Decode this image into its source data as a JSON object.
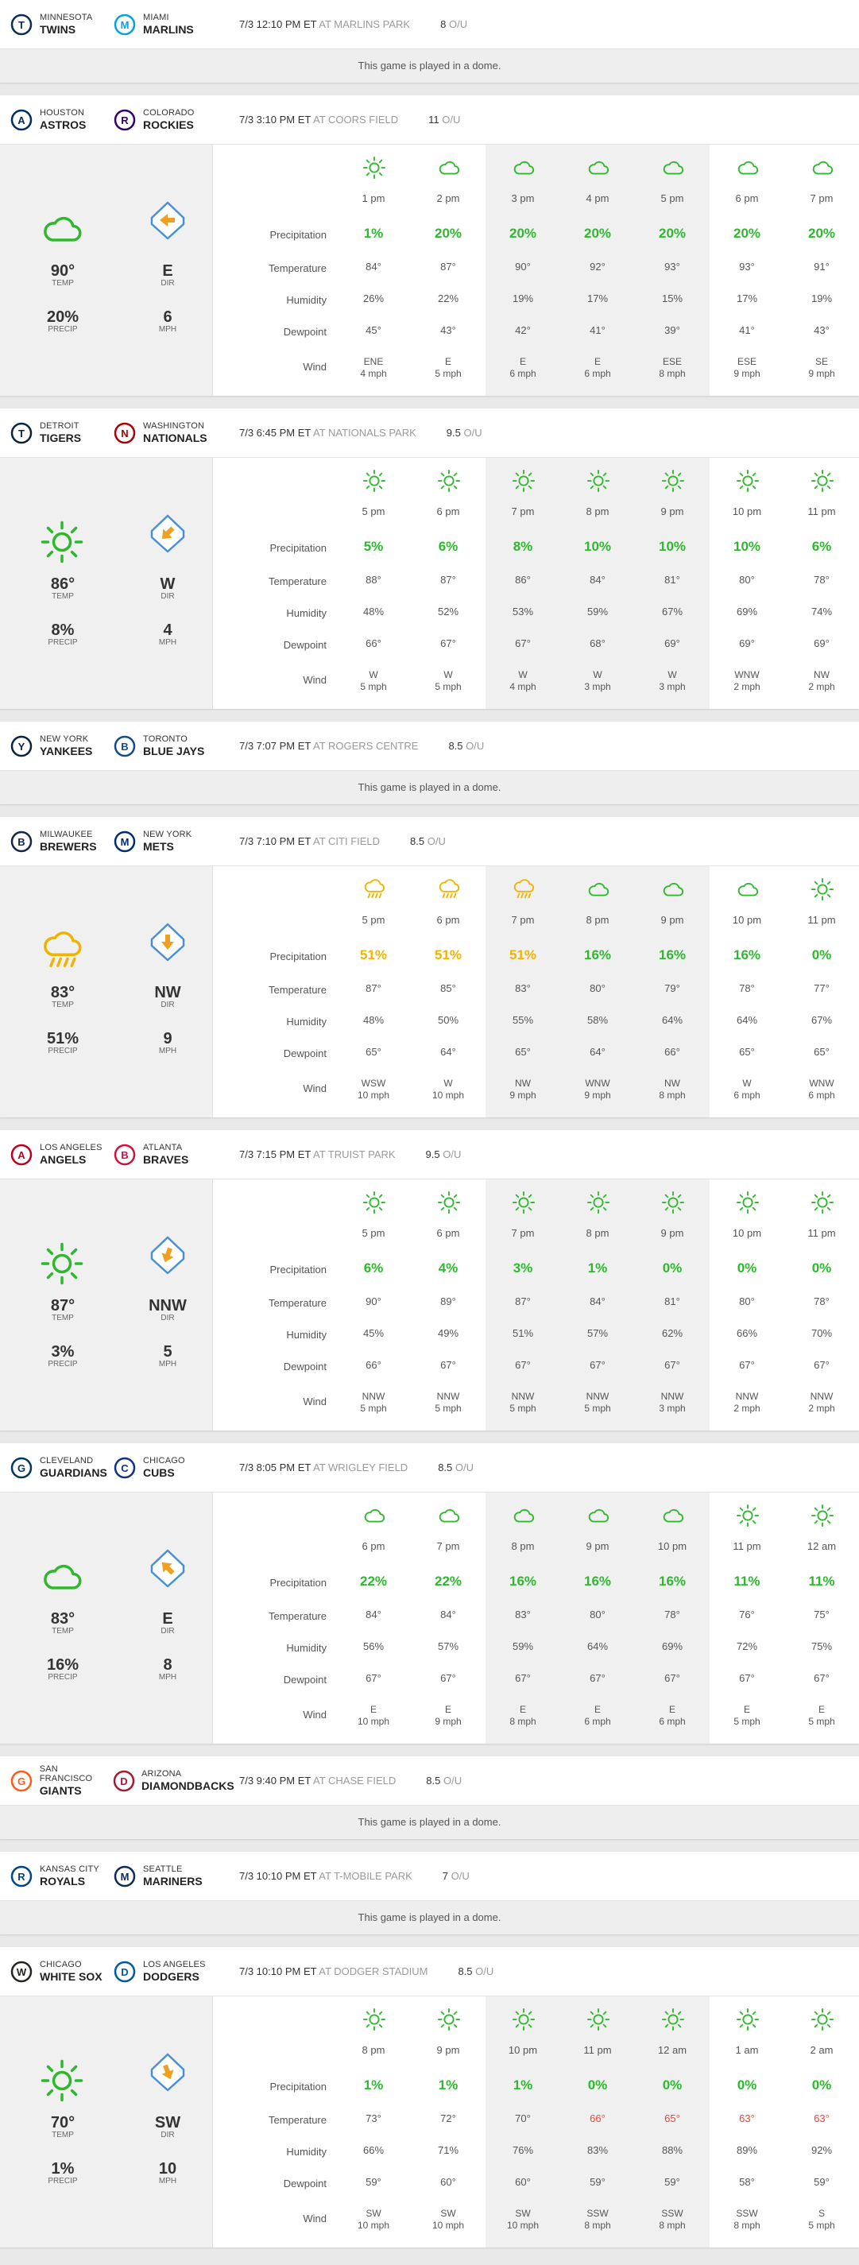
{
  "games": [
    {
      "away": {
        "city": "MINNESOTA",
        "nick": "TWINS",
        "logo": "twins-logo",
        "color": "#0c2c56"
      },
      "home": {
        "city": "MIAMI",
        "nick": "MARLINS",
        "logo": "marlins-logo",
        "color": "#00a3e0"
      },
      "datetime": "7/3 12:10 PM ET",
      "park": "AT MARLINS PARK",
      "ou": "8",
      "ou_label": "O/U",
      "dome": "This game is played in a dome."
    },
    {
      "away": {
        "city": "HOUSTON",
        "nick": "ASTROS",
        "logo": "astros-logo",
        "color": "#002d62"
      },
      "home": {
        "city": "COLORADO",
        "nick": "ROCKIES",
        "logo": "rockies-logo",
        "color": "#33006f"
      },
      "datetime": "7/3 3:10 PM ET",
      "park": "AT COORS FIELD",
      "ou": "11",
      "ou_label": "O/U",
      "summary": {
        "condition": "cloud-icon",
        "arrow_rotate": 270,
        "temp": "90°",
        "temp_label": "TEMP",
        "precip": "20%",
        "precip_label": "PRECIP",
        "dir": "E",
        "dir_label": "DIR",
        "mph": "6",
        "mph_label": "MPH"
      },
      "labels": {
        "precip": "Precipitation",
        "temp": "Temperature",
        "humidity": "Humidity",
        "dewpoint": "Dewpoint",
        "wind": "Wind"
      },
      "hours": [
        {
          "time": "1 pm",
          "icon": "sun-icon",
          "precip": "1%",
          "pcolor": "green",
          "temp": "84°",
          "humidity": "26%",
          "dewpoint": "45°",
          "wind_dir": "ENE",
          "wind_speed": "4 mph"
        },
        {
          "time": "2 pm",
          "icon": "cloud-icon",
          "precip": "20%",
          "pcolor": "green",
          "temp": "87°",
          "humidity": "22%",
          "dewpoint": "43°",
          "wind_dir": "E",
          "wind_speed": "5 mph"
        },
        {
          "time": "3 pm",
          "icon": "cloud-icon",
          "precip": "20%",
          "pcolor": "green",
          "temp": "90°",
          "humidity": "19%",
          "dewpoint": "42°",
          "wind_dir": "E",
          "wind_speed": "6 mph"
        },
        {
          "time": "4 pm",
          "icon": "cloud-icon",
          "precip": "20%",
          "pcolor": "green",
          "temp": "92°",
          "humidity": "17%",
          "dewpoint": "41°",
          "wind_dir": "E",
          "wind_speed": "6 mph"
        },
        {
          "time": "5 pm",
          "icon": "cloud-icon",
          "precip": "20%",
          "pcolor": "green",
          "temp": "93°",
          "humidity": "15%",
          "dewpoint": "39°",
          "wind_dir": "ESE",
          "wind_speed": "8 mph"
        },
        {
          "time": "6 pm",
          "icon": "cloud-icon",
          "precip": "20%",
          "pcolor": "green",
          "temp": "93°",
          "humidity": "17%",
          "dewpoint": "41°",
          "wind_dir": "ESE",
          "wind_speed": "9 mph"
        },
        {
          "time": "7 pm",
          "icon": "cloud-icon",
          "precip": "20%",
          "pcolor": "green",
          "temp": "91°",
          "humidity": "19%",
          "dewpoint": "43°",
          "wind_dir": "SE",
          "wind_speed": "9 mph"
        }
      ]
    },
    {
      "away": {
        "city": "DETROIT",
        "nick": "TIGERS",
        "logo": "tigers-logo",
        "color": "#0c2340"
      },
      "home": {
        "city": "WASHINGTON",
        "nick": "NATIONALS",
        "logo": "nationals-logo",
        "color": "#ab0003"
      },
      "datetime": "7/3 6:45 PM ET",
      "park": "AT NATIONALS PARK",
      "ou": "9.5",
      "ou_label": "O/U",
      "summary": {
        "condition": "sun-icon",
        "arrow_rotate": 225,
        "temp": "86°",
        "temp_label": "TEMP",
        "precip": "8%",
        "precip_label": "PRECIP",
        "dir": "W",
        "dir_label": "DIR",
        "mph": "4",
        "mph_label": "MPH"
      },
      "labels": {
        "precip": "Precipitation",
        "temp": "Temperature",
        "humidity": "Humidity",
        "dewpoint": "Dewpoint",
        "wind": "Wind"
      },
      "hours": [
        {
          "time": "5 pm",
          "icon": "sun-icon",
          "precip": "5%",
          "pcolor": "green",
          "temp": "88°",
          "humidity": "48%",
          "dewpoint": "66°",
          "wind_dir": "W",
          "wind_speed": "5 mph"
        },
        {
          "time": "6 pm",
          "icon": "sun-icon",
          "precip": "6%",
          "pcolor": "green",
          "temp": "87°",
          "humidity": "52%",
          "dewpoint": "67°",
          "wind_dir": "W",
          "wind_speed": "5 mph"
        },
        {
          "time": "7 pm",
          "icon": "sun-icon",
          "precip": "8%",
          "pcolor": "green",
          "temp": "86°",
          "humidity": "53%",
          "dewpoint": "67°",
          "wind_dir": "W",
          "wind_speed": "4 mph"
        },
        {
          "time": "8 pm",
          "icon": "sun-icon",
          "precip": "10%",
          "pcolor": "green",
          "temp": "84°",
          "humidity": "59%",
          "dewpoint": "68°",
          "wind_dir": "W",
          "wind_speed": "3 mph"
        },
        {
          "time": "9 pm",
          "icon": "sun-icon",
          "precip": "10%",
          "pcolor": "green",
          "temp": "81°",
          "humidity": "67%",
          "dewpoint": "69°",
          "wind_dir": "W",
          "wind_speed": "3 mph"
        },
        {
          "time": "10 pm",
          "icon": "sun-icon",
          "precip": "10%",
          "pcolor": "green",
          "temp": "80°",
          "humidity": "69%",
          "dewpoint": "69°",
          "wind_dir": "WNW",
          "wind_speed": "2 mph"
        },
        {
          "time": "11 pm",
          "icon": "sun-icon",
          "precip": "6%",
          "pcolor": "green",
          "temp": "78°",
          "humidity": "74%",
          "dewpoint": "69°",
          "wind_dir": "NW",
          "wind_speed": "2 mph"
        }
      ]
    },
    {
      "away": {
        "city": "NEW YORK",
        "nick": "YANKEES",
        "logo": "yankees-logo",
        "color": "#0c2340"
      },
      "home": {
        "city": "TORONTO",
        "nick": "BLUE JAYS",
        "logo": "bluejays-logo",
        "color": "#134a8e"
      },
      "datetime": "7/3 7:07 PM ET",
      "park": "AT ROGERS CENTRE",
      "ou": "8.5",
      "ou_label": "O/U",
      "dome": "This game is played in a dome."
    },
    {
      "away": {
        "city": "MILWAUKEE",
        "nick": "BREWERS",
        "logo": "brewers-logo",
        "color": "#12284b"
      },
      "home": {
        "city": "NEW YORK",
        "nick": "METS",
        "logo": "mets-logo",
        "color": "#002d72"
      },
      "datetime": "7/3 7:10 PM ET",
      "park": "AT CITI FIELD",
      "ou": "8.5",
      "ou_label": "O/U",
      "summary": {
        "condition": "rain-icon",
        "arrow_rotate": 180,
        "temp": "83°",
        "temp_label": "TEMP",
        "precip": "51%",
        "precip_label": "PRECIP",
        "dir": "NW",
        "dir_label": "DIR",
        "mph": "9",
        "mph_label": "MPH"
      },
      "labels": {
        "precip": "Precipitation",
        "temp": "Temperature",
        "humidity": "Humidity",
        "dewpoint": "Dewpoint",
        "wind": "Wind"
      },
      "hours": [
        {
          "time": "5 pm",
          "icon": "rain-icon",
          "precip": "51%",
          "pcolor": "yellow",
          "temp": "87°",
          "humidity": "48%",
          "dewpoint": "65°",
          "wind_dir": "WSW",
          "wind_speed": "10 mph"
        },
        {
          "time": "6 pm",
          "icon": "rain-icon",
          "precip": "51%",
          "pcolor": "yellow",
          "temp": "85°",
          "humidity": "50%",
          "dewpoint": "64°",
          "wind_dir": "W",
          "wind_speed": "10 mph"
        },
        {
          "time": "7 pm",
          "icon": "rain-icon",
          "precip": "51%",
          "pcolor": "yellow",
          "temp": "83°",
          "humidity": "55%",
          "dewpoint": "65°",
          "wind_dir": "NW",
          "wind_speed": "9 mph"
        },
        {
          "time": "8 pm",
          "icon": "cloud-icon",
          "precip": "16%",
          "pcolor": "green",
          "temp": "80°",
          "humidity": "58%",
          "dewpoint": "64°",
          "wind_dir": "WNW",
          "wind_speed": "9 mph"
        },
        {
          "time": "9 pm",
          "icon": "cloud-icon",
          "precip": "16%",
          "pcolor": "green",
          "temp": "79°",
          "humidity": "64%",
          "dewpoint": "66°",
          "wind_dir": "NW",
          "wind_speed": "8 mph"
        },
        {
          "time": "10 pm",
          "icon": "cloud-icon",
          "precip": "16%",
          "pcolor": "green",
          "temp": "78°",
          "humidity": "64%",
          "dewpoint": "65°",
          "wind_dir": "W",
          "wind_speed": "6 mph"
        },
        {
          "time": "11 pm",
          "icon": "sun-icon",
          "precip": "0%",
          "pcolor": "green",
          "temp": "77°",
          "humidity": "67%",
          "dewpoint": "65°",
          "wind_dir": "WNW",
          "wind_speed": "6 mph"
        }
      ]
    },
    {
      "away": {
        "city": "LOS ANGELES",
        "nick": "ANGELS",
        "logo": "angels-logo",
        "color": "#ba0021"
      },
      "home": {
        "city": "ATLANTA",
        "nick": "BRAVES",
        "logo": "braves-logo",
        "color": "#ce1141"
      },
      "datetime": "7/3 7:15 PM ET",
      "park": "AT TRUIST PARK",
      "ou": "9.5",
      "ou_label": "O/U",
      "summary": {
        "condition": "sun-icon",
        "arrow_rotate": 200,
        "temp": "87°",
        "temp_label": "TEMP",
        "precip": "3%",
        "precip_label": "PRECIP",
        "dir": "NNW",
        "dir_label": "DIR",
        "mph": "5",
        "mph_label": "MPH"
      },
      "labels": {
        "precip": "Precipitation",
        "temp": "Temperature",
        "humidity": "Humidity",
        "dewpoint": "Dewpoint",
        "wind": "Wind"
      },
      "hours": [
        {
          "time": "5 pm",
          "icon": "sun-icon",
          "precip": "6%",
          "pcolor": "green",
          "temp": "90°",
          "humidity": "45%",
          "dewpoint": "66°",
          "wind_dir": "NNW",
          "wind_speed": "5 mph"
        },
        {
          "time": "6 pm",
          "icon": "sun-icon",
          "precip": "4%",
          "pcolor": "green",
          "temp": "89°",
          "humidity": "49%",
          "dewpoint": "67°",
          "wind_dir": "NNW",
          "wind_speed": "5 mph"
        },
        {
          "time": "7 pm",
          "icon": "sun-icon",
          "precip": "3%",
          "pcolor": "green",
          "temp": "87°",
          "humidity": "51%",
          "dewpoint": "67°",
          "wind_dir": "NNW",
          "wind_speed": "5 mph"
        },
        {
          "time": "8 pm",
          "icon": "sun-icon",
          "precip": "1%",
          "pcolor": "green",
          "temp": "84°",
          "humidity": "57%",
          "dewpoint": "67°",
          "wind_dir": "NNW",
          "wind_speed": "5 mph"
        },
        {
          "time": "9 pm",
          "icon": "sun-icon",
          "precip": "0%",
          "pcolor": "green",
          "temp": "81°",
          "humidity": "62%",
          "dewpoint": "67°",
          "wind_dir": "NNW",
          "wind_speed": "3 mph"
        },
        {
          "time": "10 pm",
          "icon": "sun-icon",
          "precip": "0%",
          "pcolor": "green",
          "temp": "80°",
          "humidity": "66%",
          "dewpoint": "67°",
          "wind_dir": "NNW",
          "wind_speed": "2 mph"
        },
        {
          "time": "11 pm",
          "icon": "sun-icon",
          "precip": "0%",
          "pcolor": "green",
          "temp": "78°",
          "humidity": "70%",
          "dewpoint": "67°",
          "wind_dir": "NNW",
          "wind_speed": "2 mph"
        }
      ]
    },
    {
      "away": {
        "city": "CLEVELAND",
        "nick": "GUARDIANS",
        "logo": "guardians-logo",
        "color": "#00385d"
      },
      "home": {
        "city": "CHICAGO",
        "nick": "CUBS",
        "logo": "cubs-logo",
        "color": "#0e3386"
      },
      "datetime": "7/3 8:05 PM ET",
      "park": "AT WRIGLEY FIELD",
      "ou": "8.5",
      "ou_label": "O/U",
      "summary": {
        "condition": "cloud-icon",
        "arrow_rotate": 315,
        "temp": "83°",
        "temp_label": "TEMP",
        "precip": "16%",
        "precip_label": "PRECIP",
        "dir": "E",
        "dir_label": "DIR",
        "mph": "8",
        "mph_label": "MPH"
      },
      "labels": {
        "precip": "Precipitation",
        "temp": "Temperature",
        "humidity": "Humidity",
        "dewpoint": "Dewpoint",
        "wind": "Wind"
      },
      "hours": [
        {
          "time": "6 pm",
          "icon": "cloud-icon",
          "precip": "22%",
          "pcolor": "green",
          "temp": "84°",
          "humidity": "56%",
          "dewpoint": "67°",
          "wind_dir": "E",
          "wind_speed": "10 mph"
        },
        {
          "time": "7 pm",
          "icon": "cloud-icon",
          "precip": "22%",
          "pcolor": "green",
          "temp": "84°",
          "humidity": "57%",
          "dewpoint": "67°",
          "wind_dir": "E",
          "wind_speed": "9 mph"
        },
        {
          "time": "8 pm",
          "icon": "cloud-icon",
          "precip": "16%",
          "pcolor": "green",
          "temp": "83°",
          "humidity": "59%",
          "dewpoint": "67°",
          "wind_dir": "E",
          "wind_speed": "8 mph"
        },
        {
          "time": "9 pm",
          "icon": "cloud-icon",
          "precip": "16%",
          "pcolor": "green",
          "temp": "80°",
          "humidity": "64%",
          "dewpoint": "67°",
          "wind_dir": "E",
          "wind_speed": "6 mph"
        },
        {
          "time": "10 pm",
          "icon": "cloud-icon",
          "precip": "16%",
          "pcolor": "green",
          "temp": "78°",
          "humidity": "69%",
          "dewpoint": "67°",
          "wind_dir": "E",
          "wind_speed": "6 mph"
        },
        {
          "time": "11 pm",
          "icon": "sun-icon",
          "precip": "11%",
          "pcolor": "green",
          "temp": "76°",
          "humidity": "72%",
          "dewpoint": "67°",
          "wind_dir": "E",
          "wind_speed": "5 mph"
        },
        {
          "time": "12 am",
          "icon": "sun-icon",
          "precip": "11%",
          "pcolor": "green",
          "temp": "75°",
          "humidity": "75%",
          "dewpoint": "67°",
          "wind_dir": "E",
          "wind_speed": "5 mph"
        }
      ]
    },
    {
      "away": {
        "city": "SAN FRANCISCO",
        "nick": "GIANTS",
        "logo": "giants-logo",
        "color": "#fd5a1e"
      },
      "home": {
        "city": "ARIZONA",
        "nick": "DIAMONDBACKS",
        "logo": "diamondbacks-logo",
        "color": "#a71930"
      },
      "datetime": "7/3 9:40 PM ET",
      "park": "AT CHASE FIELD",
      "ou": "8.5",
      "ou_label": "O/U",
      "dome": "This game is played in a dome."
    },
    {
      "away": {
        "city": "KANSAS CITY",
        "nick": "ROYALS",
        "logo": "royals-logo",
        "color": "#004687"
      },
      "home": {
        "city": "SEATTLE",
        "nick": "MARINERS",
        "logo": "mariners-logo",
        "color": "#0c2c56"
      },
      "datetime": "7/3 10:10 PM ET",
      "park": "AT T-MOBILE PARK",
      "ou": "7",
      "ou_label": "O/U",
      "dome": "This game is played in a dome."
    },
    {
      "away": {
        "city": "CHICAGO",
        "nick": "WHITE SOX",
        "logo": "whitesox-logo",
        "color": "#27251f"
      },
      "home": {
        "city": "LOS ANGELES",
        "nick": "DODGERS",
        "logo": "dodgers-logo",
        "color": "#005a9c"
      },
      "datetime": "7/3 10:10 PM ET",
      "park": "AT DODGER STADIUM",
      "ou": "8.5",
      "ou_label": "O/U",
      "summary": {
        "condition": "sun-icon",
        "arrow_rotate": 160,
        "temp": "70°",
        "temp_label": "TEMP",
        "precip": "1%",
        "precip_label": "PRECIP",
        "dir": "SW",
        "dir_label": "DIR",
        "mph": "10",
        "mph_label": "MPH"
      },
      "labels": {
        "precip": "Precipitation",
        "temp": "Temperature",
        "humidity": "Humidity",
        "dewpoint": "Dewpoint",
        "wind": "Wind"
      },
      "hours": [
        {
          "time": "8 pm",
          "icon": "sun-icon",
          "precip": "1%",
          "pcolor": "green",
          "temp": "73°",
          "humidity": "66%",
          "dewpoint": "59°",
          "wind_dir": "SW",
          "wind_speed": "10 mph"
        },
        {
          "time": "9 pm",
          "icon": "sun-icon",
          "precip": "1%",
          "pcolor": "green",
          "temp": "72°",
          "humidity": "71%",
          "dewpoint": "60°",
          "wind_dir": "SW",
          "wind_speed": "10 mph"
        },
        {
          "time": "10 pm",
          "icon": "sun-icon",
          "precip": "1%",
          "pcolor": "green",
          "temp": "70°",
          "humidity": "76%",
          "dewpoint": "60°",
          "wind_dir": "SW",
          "wind_speed": "10 mph"
        },
        {
          "time": "11 pm",
          "icon": "sun-icon",
          "precip": "0%",
          "pcolor": "green",
          "temp": "66°",
          "tcolor": "hot",
          "humidity": "83%",
          "dewpoint": "59°",
          "wind_dir": "SSW",
          "wind_speed": "8 mph"
        },
        {
          "time": "12 am",
          "icon": "sun-icon",
          "precip": "0%",
          "pcolor": "green",
          "temp": "65°",
          "tcolor": "hot",
          "humidity": "88%",
          "dewpoint": "59°",
          "wind_dir": "SSW",
          "wind_speed": "8 mph"
        },
        {
          "time": "1 am",
          "icon": "sun-icon",
          "precip": "0%",
          "pcolor": "green",
          "temp": "63°",
          "tcolor": "hot",
          "humidity": "89%",
          "dewpoint": "58°",
          "wind_dir": "SSW",
          "wind_speed": "8 mph"
        },
        {
          "time": "2 am",
          "icon": "sun-icon",
          "precip": "0%",
          "pcolor": "green",
          "temp": "63°",
          "tcolor": "hot",
          "humidity": "92%",
          "dewpoint": "59°",
          "wind_dir": "S",
          "wind_speed": "5 mph"
        }
      ]
    }
  ]
}
